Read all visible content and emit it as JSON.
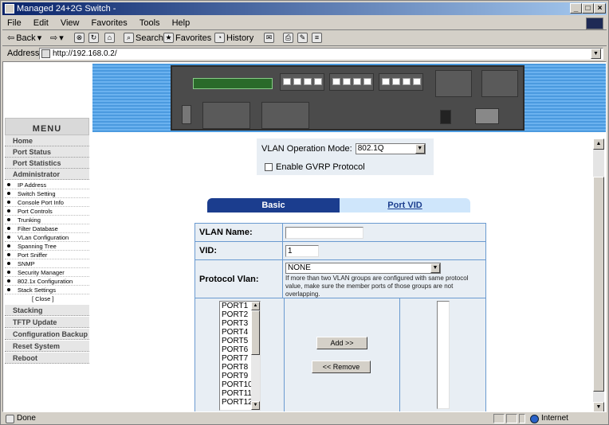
{
  "window": {
    "title": "Managed 24+2G Switch -"
  },
  "menubar": [
    "File",
    "Edit",
    "View",
    "Favorites",
    "Tools",
    "Help"
  ],
  "toolbar": {
    "back": "Back",
    "search": "Search",
    "favorites": "Favorites",
    "history": "History"
  },
  "address": {
    "label": "Address",
    "url": "http://192.168.0.2/"
  },
  "menu": {
    "header": "MENU",
    "items": [
      "Home",
      "Port Status",
      "Port Statistics",
      "Administrator"
    ],
    "subitems": [
      "IP Address",
      "Switch Setting",
      "Console Port Info",
      "Port Controls",
      "Trunking",
      "Filter Database",
      "VLan Configuration",
      "Spanning Tree",
      "Port Sniffer",
      "SNMP",
      "Security Manager",
      "802.1x Configuration",
      "Stack Settings"
    ],
    "close": "[ Close ]",
    "items2": [
      "Stacking",
      "TFTP Update Firmware",
      "Configuration Backup",
      "Reset System",
      "Reboot"
    ]
  },
  "vlan": {
    "op_mode_label": "VLAN Operation Mode:",
    "op_mode_value": "802.1Q",
    "gvrp_label": "Enable GVRP Protocol"
  },
  "tabs": {
    "basic": "Basic",
    "port_vid": "Port VID"
  },
  "form": {
    "vlan_name_label": "VLAN Name:",
    "vlan_name_value": "",
    "vid_label": "VID:",
    "vid_value": "1",
    "protocol_label": "Protocol Vlan:",
    "protocol_value": "NONE",
    "protocol_help": "If more than two VLAN groups are configured with same protocol value, make sure the member ports of those groups are not overlapping.",
    "ports": [
      "PORT1",
      "PORT2",
      "PORT3",
      "PORT4",
      "PORT5",
      "PORT6",
      "PORT7",
      "PORT8",
      "PORT9",
      "PORT10",
      "PORT11",
      "PORT12"
    ],
    "add_label": "Add   >>",
    "remove_label": "<< Remove"
  },
  "status": {
    "text": "Done",
    "zone": "Internet"
  }
}
